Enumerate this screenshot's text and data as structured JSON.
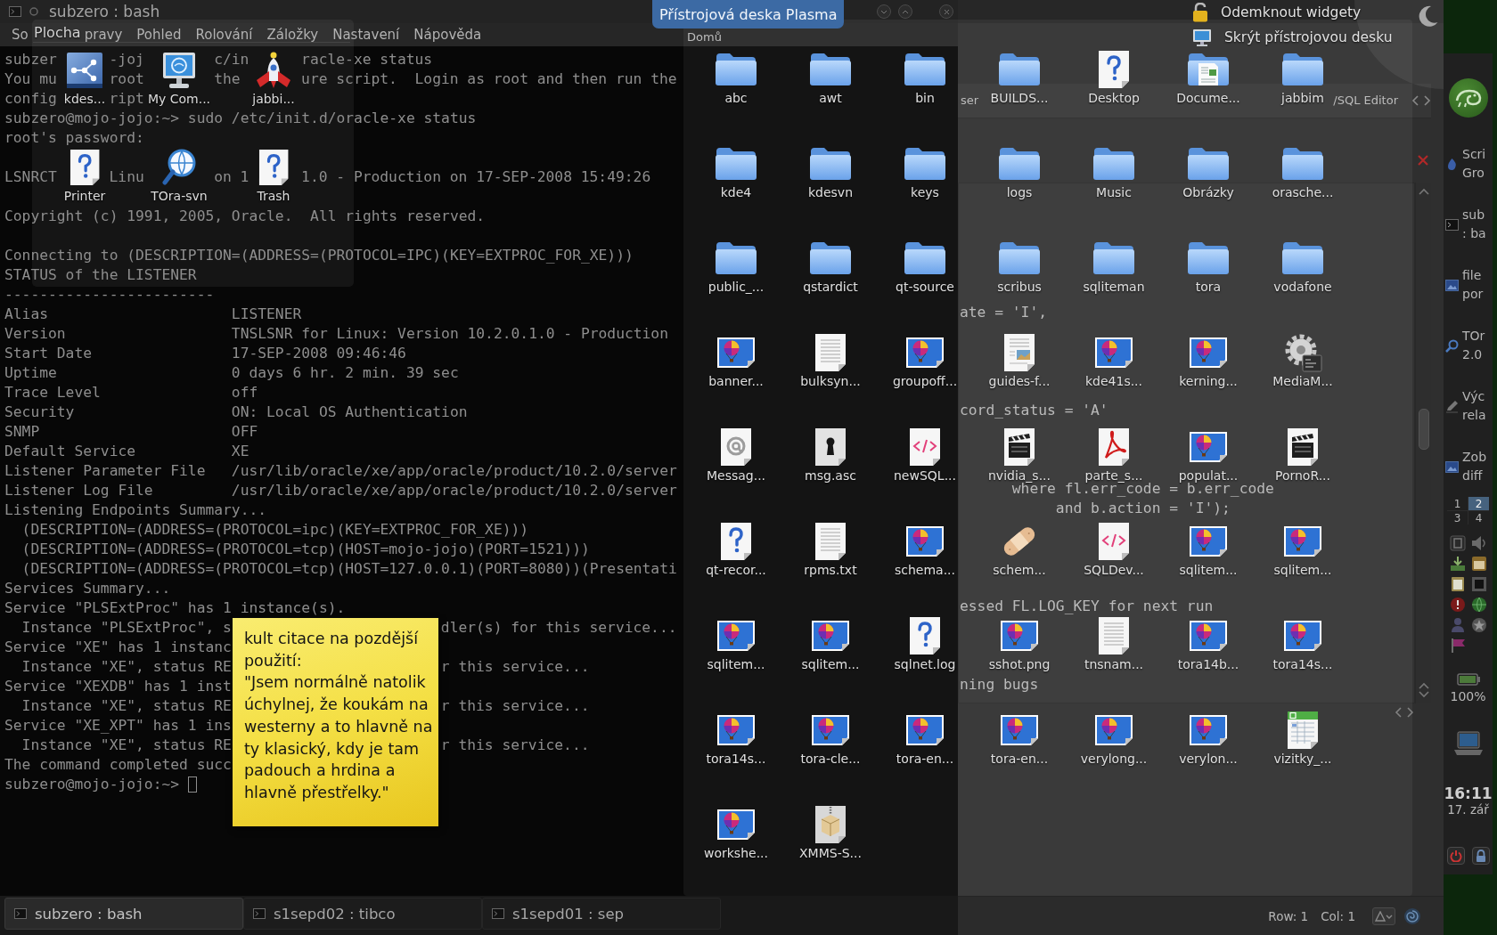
{
  "terminal": {
    "title": "subzero : bash",
    "menu": [
      "So",
      "pravy",
      "Pohled",
      "Rolování",
      "Záložky",
      "Nastavení",
      "Nápověda"
    ],
    "lines": [
      {
        "kind": "behind-icons",
        "parts": [
          "subzer",
          "-joj",
          "c/in",
          "racle-xe status"
        ]
      },
      {
        "kind": "behind-icons",
        "parts": [
          "You mu",
          "root",
          "the",
          "ure script.  Login as root and then run the"
        ]
      },
      {
        "kind": "behind-icons",
        "parts": [
          "config",
          "ript"
        ]
      },
      {
        "kind": "text",
        "text": "subzero@mojo-jojo:~> sudo /etc/init.d/oracle-xe status"
      },
      {
        "kind": "text",
        "text": "root's password:"
      },
      {
        "kind": "blank"
      },
      {
        "kind": "behind-icons",
        "parts": [
          "LSNRCT",
          "Linu",
          "on 1",
          "1.0 - Production on 17-SEP-2008 15:49:26"
        ]
      },
      {
        "kind": "blank"
      },
      {
        "kind": "text",
        "text": "Copyright (c) 1991, 2005, Oracle.  All rights reserved."
      },
      {
        "kind": "blank"
      },
      {
        "kind": "text",
        "text": "Connecting to (DESCRIPTION=(ADDRESS=(PROTOCOL=IPC)(KEY=EXTPROC_FOR_XE)))"
      },
      {
        "kind": "text",
        "text": "STATUS of the LISTENER"
      },
      {
        "kind": "text",
        "text": "------------------------"
      },
      {
        "kind": "text",
        "text": "Alias                     LISTENER"
      },
      {
        "kind": "text",
        "text": "Version                   TNSLSNR for Linux: Version 10.2.0.1.0 - Production"
      },
      {
        "kind": "text",
        "text": "Start Date                17-SEP-2008 09:46:46"
      },
      {
        "kind": "text",
        "text": "Uptime                    0 days 6 hr. 2 min. 39 sec"
      },
      {
        "kind": "text",
        "text": "Trace Level               off"
      },
      {
        "kind": "text",
        "text": "Security                  ON: Local OS Authentication"
      },
      {
        "kind": "text",
        "text": "SNMP                      OFF"
      },
      {
        "kind": "text",
        "text": "Default Service           XE"
      },
      {
        "kind": "text",
        "text": "Listener Parameter File   /usr/lib/oracle/xe/app/oracle/product/10.2.0/server"
      },
      {
        "kind": "text",
        "text": "Listener Log File         /usr/lib/oracle/xe/app/oracle/product/10.2.0/server"
      },
      {
        "kind": "text",
        "text": "Listening Endpoints Summary..."
      },
      {
        "kind": "text",
        "text": "  (DESCRIPTION=(ADDRESS=(PROTOCOL=ipc)(KEY=EXTPROC_FOR_XE)))"
      },
      {
        "kind": "text",
        "text": "  (DESCRIPTION=(ADDRESS=(PROTOCOL=tcp)(HOST=mojo-jojo)(PORT=1521)))"
      },
      {
        "kind": "text",
        "text": "  (DESCRIPTION=(ADDRESS=(PROTOCOL=tcp)(HOST=127.0.0.1)(PORT=8080))(Presentati"
      },
      {
        "kind": "text",
        "text": "Services Summary..."
      },
      {
        "kind": "text",
        "text": "Service \"PLSExtProc\" has 1 instance(s)."
      },
      {
        "kind": "behind-note",
        "parts": [
          "  Instance \"PLSExtProc\", s",
          "dler(s) for this service..."
        ]
      },
      {
        "kind": "behind-note",
        "parts": [
          "Service \"XE\" has 1 instanc"
        ]
      },
      {
        "kind": "behind-note",
        "parts": [
          "  Instance \"XE\", status RE",
          "r this service..."
        ]
      },
      {
        "kind": "behind-note",
        "parts": [
          "Service \"XEXDB\" has 1 inst"
        ]
      },
      {
        "kind": "behind-note",
        "parts": [
          "  Instance \"XE\", status RE",
          "r this service..."
        ]
      },
      {
        "kind": "behind-note",
        "parts": [
          "Service \"XE_XPT\" has 1 ins"
        ]
      },
      {
        "kind": "behind-note",
        "parts": [
          "  Instance \"XE\", status RE",
          "r this service..."
        ]
      },
      {
        "kind": "behind-note",
        "parts": [
          "The command completed succ"
        ]
      },
      {
        "kind": "prompt",
        "text": "subzero@mojo-jojo:~>"
      }
    ],
    "tabs": [
      {
        "label": "subzero : bash",
        "selected": true
      },
      {
        "label": "s1sepd02 : tibco",
        "selected": false
      },
      {
        "label": "s1sepd01 : sep",
        "selected": false
      }
    ]
  },
  "tora": {
    "tab_titles": [
      "ser",
      "/SQL Editor"
    ],
    "editor_lines": [
      {
        "kind": "covered"
      },
      {
        "kind": "covered"
      },
      {
        "kind": "covered"
      },
      {
        "kind": "covered"
      },
      {
        "kind": "covered"
      },
      {
        "kind": "covered"
      },
      {
        "kind": "text",
        "text": "ate = 'I',"
      },
      {
        "kind": "covered"
      },
      {
        "kind": "covered"
      },
      {
        "kind": "covered"
      },
      {
        "kind": "covered"
      },
      {
        "kind": "text",
        "text": "cord_status = 'A'"
      },
      {
        "kind": "covered"
      },
      {
        "kind": "covered"
      },
      {
        "kind": "covered"
      },
      {
        "kind": "text",
        "text": "      where fl.err_code = b.err_code"
      },
      {
        "kind": "text",
        "text": "           and b.action = 'I');"
      },
      {
        "kind": "covered"
      },
      {
        "kind": "covered"
      },
      {
        "kind": "covered"
      },
      {
        "kind": "covered"
      },
      {
        "kind": "text",
        "text": "essed FL.LOG_KEY for next run"
      },
      {
        "kind": "covered"
      },
      {
        "kind": "covered"
      },
      {
        "kind": "covered"
      },
      {
        "kind": "text",
        "text": "ning bugs"
      }
    ],
    "status_bar": {
      "row": "Row: 1",
      "col": "Col: 1"
    }
  },
  "dashboard": {
    "title": "Přístrojová deska Plasma",
    "toolbox": [
      {
        "kind": "lock",
        "label": "Odemknout widgety"
      },
      {
        "kind": "monitor",
        "label": "Skrýt přístrojovou desku"
      }
    ],
    "desktop_widget": {
      "title": "Plocha",
      "items": [
        {
          "kind": "network",
          "label": "kdes..."
        },
        {
          "kind": "monitor",
          "label": "My Com..."
        },
        {
          "kind": "rocket",
          "label": "jabbi..."
        },
        {
          "kind": "unknown",
          "label": "Printer"
        },
        {
          "kind": "magnifier",
          "label": "TOra-svn"
        },
        {
          "kind": "unknown",
          "label": "Trash"
        }
      ]
    },
    "folder_view": {
      "title": "Domů",
      "items": [
        {
          "kind": "folder",
          "label": "abc"
        },
        {
          "kind": "folder",
          "label": "awt"
        },
        {
          "kind": "folder",
          "label": "bin"
        },
        {
          "kind": "folder",
          "label": "BUILDS..."
        },
        {
          "kind": "unknown",
          "label": "Desktop"
        },
        {
          "kind": "folder-doc",
          "label": "Docume..."
        },
        {
          "kind": "folder",
          "label": "jabbim"
        },
        {
          "kind": "folder",
          "label": "kde4"
        },
        {
          "kind": "folder",
          "label": "kdesvn"
        },
        {
          "kind": "folder",
          "label": "keys"
        },
        {
          "kind": "folder",
          "label": "logs"
        },
        {
          "kind": "folder",
          "label": "Music"
        },
        {
          "kind": "folder",
          "label": "Obrázky"
        },
        {
          "kind": "folder",
          "label": "orasche..."
        },
        {
          "kind": "folder",
          "label": "public_..."
        },
        {
          "kind": "folder",
          "label": "qstardict"
        },
        {
          "kind": "folder",
          "label": "qt-source"
        },
        {
          "kind": "folder",
          "label": "scribus"
        },
        {
          "kind": "folder",
          "label": "sqliteman"
        },
        {
          "kind": "folder",
          "label": "tora"
        },
        {
          "kind": "folder",
          "label": "vodafone"
        },
        {
          "kind": "image",
          "label": "banner..."
        },
        {
          "kind": "text",
          "label": "bulksyn..."
        },
        {
          "kind": "image",
          "label": "groupoff..."
        },
        {
          "kind": "doc-picture",
          "label": "guides-f..."
        },
        {
          "kind": "image",
          "label": "kde41s..."
        },
        {
          "kind": "image",
          "label": "kerning..."
        },
        {
          "kind": "executable",
          "label": "MediaM..."
        },
        {
          "kind": "mail",
          "label": "Messag..."
        },
        {
          "kind": "key",
          "label": "msg.asc"
        },
        {
          "kind": "code",
          "label": "newSQL..."
        },
        {
          "kind": "video",
          "label": "nvidia_s..."
        },
        {
          "kind": "pdf",
          "label": "parte_s..."
        },
        {
          "kind": "image",
          "label": "populat..."
        },
        {
          "kind": "video",
          "label": "PornoR..."
        },
        {
          "kind": "unknown",
          "label": "qt-recor..."
        },
        {
          "kind": "text",
          "label": "rpms.txt"
        },
        {
          "kind": "image",
          "label": "schema..."
        },
        {
          "kind": "patch",
          "label": "schem..."
        },
        {
          "kind": "code",
          "label": "SQLDev..."
        },
        {
          "kind": "image",
          "label": "sqlitem..."
        },
        {
          "kind": "image",
          "label": "sqlitem..."
        },
        {
          "kind": "image",
          "label": "sqlitem..."
        },
        {
          "kind": "image",
          "label": "sqlitem..."
        },
        {
          "kind": "unknown",
          "label": "sqlnet.log"
        },
        {
          "kind": "image",
          "label": "sshot.png"
        },
        {
          "kind": "text",
          "label": "tnsnam..."
        },
        {
          "kind": "image",
          "label": "tora14b..."
        },
        {
          "kind": "image",
          "label": "tora14s..."
        },
        {
          "kind": "image",
          "label": "tora14s..."
        },
        {
          "kind": "image",
          "label": "tora-cle..."
        },
        {
          "kind": "image",
          "label": "tora-en..."
        },
        {
          "kind": "image",
          "label": "tora-en..."
        },
        {
          "kind": "image",
          "label": "verylong..."
        },
        {
          "kind": "image",
          "label": "verylon..."
        },
        {
          "kind": "spreadsheet",
          "label": "vizitky_..."
        },
        {
          "kind": "image",
          "label": "workshe..."
        },
        {
          "kind": "archive",
          "label": "XMMS-S..."
        }
      ]
    },
    "note": {
      "paragraphs": [
        "kult citace na pozdější použití:",
        "\"Jsem normálně natolik úchylnej, že koukám na westerny a to hlavně na ty klasický, kdy je tam padouch a hrdina a hlavně přestřelky.\""
      ]
    }
  },
  "panel": {
    "tasks": [
      {
        "kind": "drop",
        "lines": [
          "Scri",
          "Gro"
        ]
      },
      {
        "kind": "terminal",
        "lines": [
          "sub",
          ": ba"
        ]
      },
      {
        "kind": "image",
        "lines": [
          "file",
          "por"
        ]
      },
      {
        "kind": "magnifier",
        "lines": [
          "TOr",
          "2.0"
        ]
      },
      {
        "kind": "pencil",
        "lines": [
          "Výc",
          "rela"
        ]
      },
      {
        "kind": "image",
        "lines": [
          "Zob",
          "diff"
        ]
      }
    ],
    "pager": [
      {
        "label": "1",
        "selected": false
      },
      {
        "label": "2",
        "selected": true
      },
      {
        "label": "3",
        "selected": false
      },
      {
        "label": "4",
        "selected": false
      }
    ],
    "battery": "100%",
    "clock": {
      "time": "16:11",
      "date": "17. zář"
    }
  }
}
